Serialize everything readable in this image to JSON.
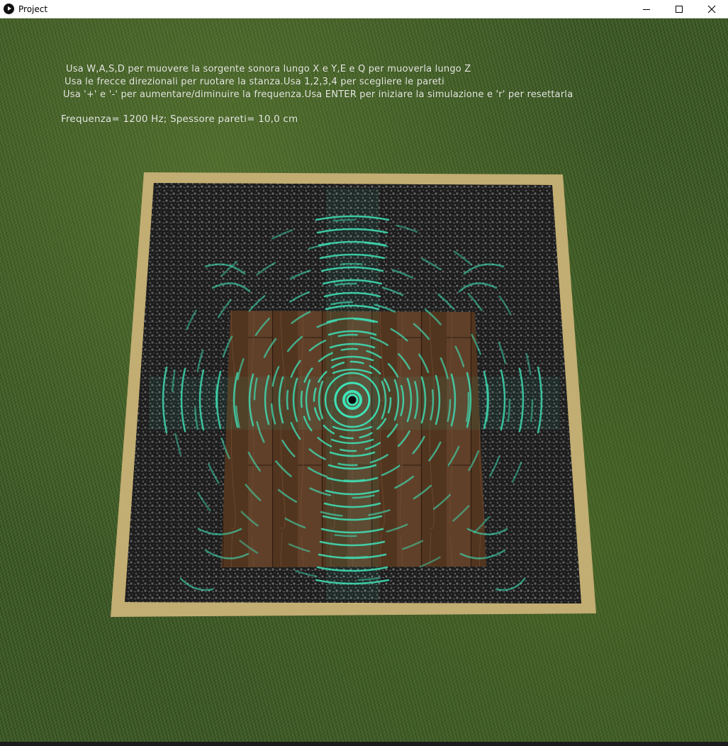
{
  "window": {
    "title": "Project",
    "controls": {
      "minimize": "minimize-icon",
      "maximize": "maximize-icon",
      "close": "close-icon"
    }
  },
  "hud": {
    "line1": "Usa W,A,S,D per muovere la sorgente sonora lungo X e Y,E e Q per muoverla lungo Z",
    "line2": "Usa le frecce direzionali per ruotare la stanza.Usa 1,2,3,4 per scegliere le pareti",
    "line3": "Usa '+' e '-' per aumentare/diminuire la frequenza.Usa ENTER per iniziare la simulazione e 'r' per resettarla",
    "frequency": "Frequenza=   1200 Hz; Spessore pareti=   10,0 cm"
  },
  "colors": {
    "wave": "#3fe3b8",
    "frame": "#c2ad72",
    "wall": "#1b1b1b",
    "floor": "#5a3a26",
    "grass": "#37551f"
  }
}
